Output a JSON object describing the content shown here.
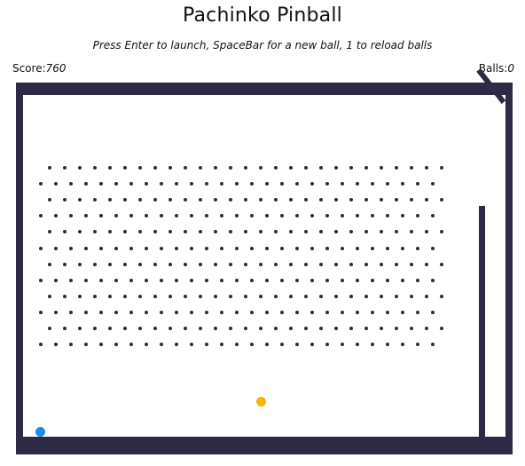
{
  "header": {
    "title": "Pachinko Pinball",
    "instructions": "Press Enter to launch, SpaceBar for a new ball, 1 to reload balls"
  },
  "hud": {
    "score_label": "Score:",
    "score_value": "760",
    "balls_label": "Balls:",
    "balls_value": "0"
  },
  "colors": {
    "frame": "#2d2a45",
    "peg": "#2d2a45",
    "active_ball": "#f2b800",
    "launcher_ball": "#1a8ef0"
  }
}
